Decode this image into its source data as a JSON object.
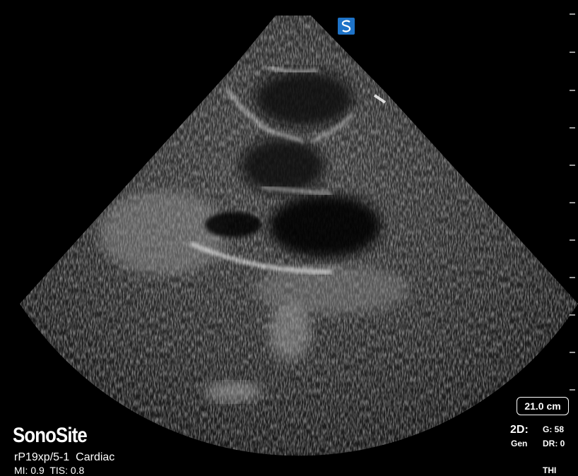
{
  "brand": "SonoSite",
  "probe_line": "rP19xp/5-1  Cardiac",
  "mi_line": "MI: 0.9  TIS: 0.8",
  "depth": "21.0 cm",
  "mode": "2D:",
  "mode_sub": "Gen",
  "gain": "G: 58",
  "dynamic_range": "DR: 0",
  "thi": "THI",
  "icons": {
    "orientation_marker": "sonosite-logo-icon"
  },
  "colors": {
    "marker": "#1e73c8",
    "background": "#000000",
    "text": "#ffffff"
  }
}
